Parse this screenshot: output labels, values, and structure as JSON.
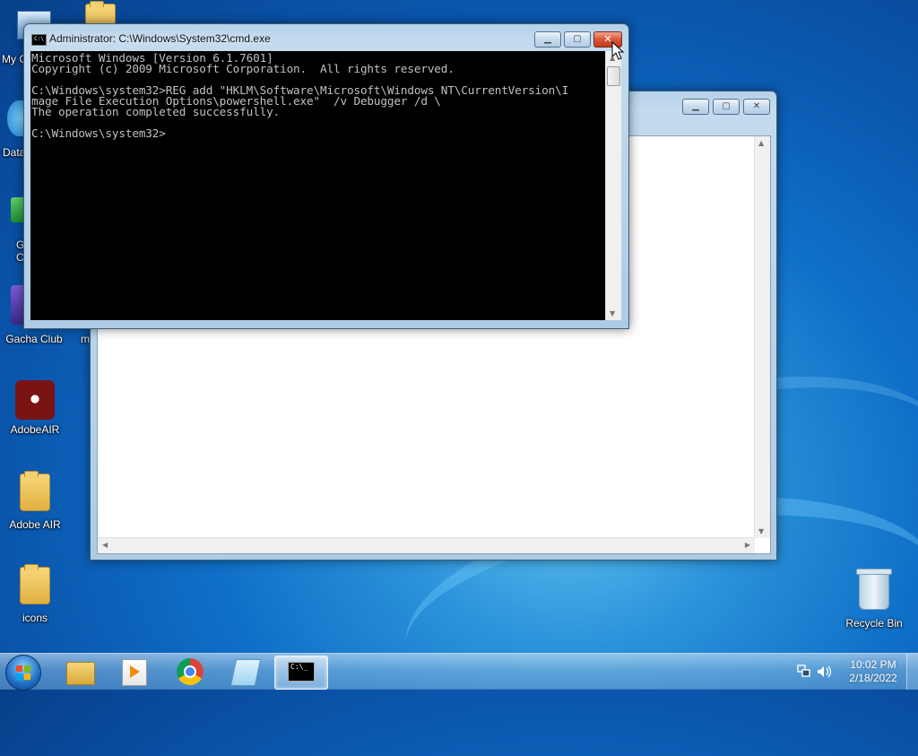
{
  "desktop": {
    "icons": [
      {
        "label": "My C"
      },
      {
        "label": "Data"
      },
      {
        "label": "G\nC"
      },
      {
        "label": "Gacha Club"
      },
      {
        "label": "m"
      },
      {
        "label": "AdobeAIR"
      },
      {
        "label": "Adobe AIR"
      },
      {
        "label": "icons"
      },
      {
        "label": "Recycle Bin"
      }
    ]
  },
  "cmd_window": {
    "title": "Administrator: C:\\Windows\\System32\\cmd.exe",
    "icon_text": "C:\\",
    "console_text": "Microsoft Windows [Version 6.1.7601]\nCopyright (c) 2009 Microsoft Corporation.  All rights reserved.\n\nC:\\Windows\\system32>REG add \"HKLM\\Software\\Microsoft\\Windows NT\\CurrentVersion\\I\nmage File Execution Options\\powershell.exe\"  /v Debugger /d \\\nThe operation completed successfully.\n\nC:\\Windows\\system32>",
    "minimize_label": "▁",
    "maximize_label": "▢",
    "close_label": "✕"
  },
  "background_window": {
    "minimize_label": "▁",
    "maximize_label": "▢",
    "close_label": "✕"
  },
  "taskbar": {
    "apps": [
      {
        "name": "explorer"
      },
      {
        "name": "media-player"
      },
      {
        "name": "chrome"
      },
      {
        "name": "notepad"
      },
      {
        "name": "cmd",
        "icon_text": "C:\\_",
        "active": true
      }
    ],
    "clock_time": "10:02 PM",
    "clock_date": "2/18/2022"
  },
  "colors": {
    "console_bg": "#000000",
    "console_fg": "#c0c0c0",
    "close_button": "#c7401f",
    "desktop_blue": "#0f6fc7"
  }
}
